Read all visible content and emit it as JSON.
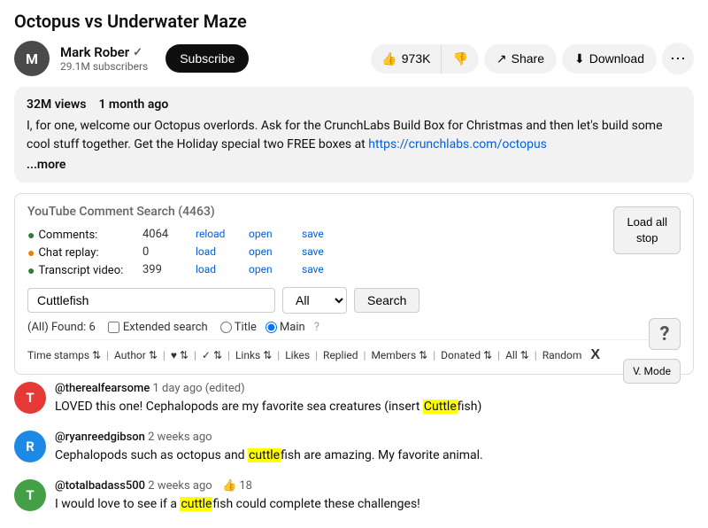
{
  "page": {
    "title": "Octopus vs Underwater Maze"
  },
  "channel": {
    "name": "Mark Rober",
    "verified": true,
    "subscribers": "29.1M subscribers",
    "avatar_initial": "M",
    "avatar_bg": "#4a4a4a"
  },
  "buttons": {
    "subscribe": "Subscribe",
    "share": "Share",
    "download": "Download",
    "load_stop_line1": "Load all",
    "load_stop_line2": "stop",
    "search": "Search",
    "v_mode": "V. Mode",
    "more": "⋯"
  },
  "stats": {
    "likes": "973K",
    "views": "32M views",
    "posted": "1 month ago"
  },
  "description": {
    "text": "I, for one, welcome our Octopus overlords. Ask for the CrunchLabs Build Box for Christmas and then let's build some cool stuff together. Get the Holiday special two FREE boxes at",
    "link_text": "https://crunchlabs.com/octopus",
    "link_url": "#",
    "more": "...more"
  },
  "comment_search": {
    "title": "YouTube Comment Search",
    "count": "(4463)",
    "comments_label": "Comments:",
    "comments_value": "4064",
    "chat_label": "Chat replay:",
    "chat_value": "0",
    "transcript_label": "Transcript video:",
    "transcript_value": "399",
    "reload_label": "reload",
    "load_label": "load",
    "open_label": "open",
    "save_label": "save",
    "search_query": "Cuttlefish",
    "filter_option": "All",
    "filter_options": [
      "All",
      "Title",
      "Main"
    ],
    "found_text": "(All) Found: 6",
    "extended_search": "Extended search",
    "title_radio": "Title",
    "main_radio": "Main",
    "question_mark": "?",
    "sort_columns": [
      {
        "label": "Time stamps",
        "icon": "⇅"
      },
      {
        "label": "Author",
        "icon": "⇅"
      },
      {
        "label": "♥",
        "icon": "⇅"
      },
      {
        "label": "✓",
        "icon": "⇅"
      },
      {
        "label": "Links",
        "icon": "⇅"
      },
      {
        "label": "Likes"
      },
      {
        "label": "Replied"
      },
      {
        "label": "Members",
        "icon": "⇅"
      },
      {
        "label": "Donated",
        "icon": "⇅"
      },
      {
        "label": "All",
        "icon": "⇅"
      },
      {
        "label": "Random"
      },
      {
        "label": "X"
      }
    ]
  },
  "comments": [
    {
      "id": 1,
      "author": "@therealfearsome",
      "time": "1 day ago (edited)",
      "text_before": "LOVED this one! Cephalopods are my favorite sea creatures (insert ",
      "highlight": "Cuttle",
      "text_after": "fish)",
      "avatar_color": "#e53935",
      "avatar_initial": "T"
    },
    {
      "id": 2,
      "author": "@ryanreedgibson",
      "time": "2 weeks ago",
      "text_before": "Cephalopods such as octopus and ",
      "highlight": "cuttle",
      "text_after": "fish are amazing. My favorite animal.",
      "avatar_color": "#1e88e5",
      "avatar_initial": "R"
    },
    {
      "id": 3,
      "author": "@totalbadass500",
      "time": "2 weeks ago",
      "likes": "18",
      "text_before": "I would love to see if a ",
      "highlight": "cuttle",
      "text_after": "fish could complete these challenges!",
      "avatar_color": "#43a047",
      "avatar_initial": "T"
    }
  ]
}
